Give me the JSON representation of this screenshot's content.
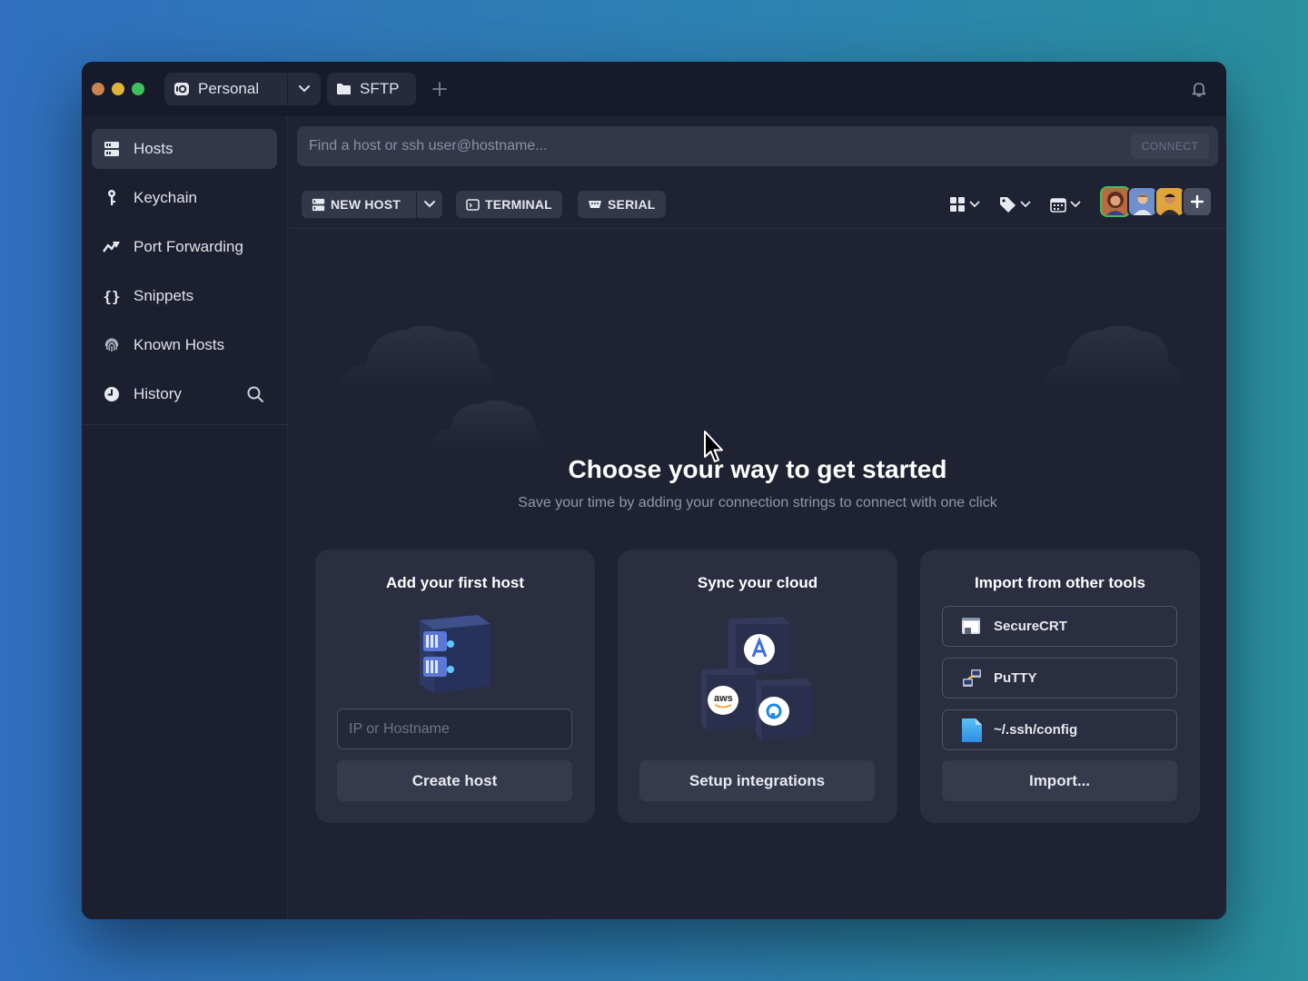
{
  "titlebar": {
    "vault_label": "Personal",
    "sftp_label": "SFTP"
  },
  "sidebar": {
    "items": [
      {
        "label": "Hosts",
        "icon": "hosts-icon"
      },
      {
        "label": "Keychain",
        "icon": "key-icon"
      },
      {
        "label": "Port Forwarding",
        "icon": "port-forwarding-icon"
      },
      {
        "label": "Snippets",
        "icon": "braces-icon"
      },
      {
        "label": "Known Hosts",
        "icon": "fingerprint-icon"
      },
      {
        "label": "History",
        "icon": "clock-icon"
      }
    ]
  },
  "search": {
    "placeholder": "Find a host or ssh user@hostname...",
    "connect_label": "CONNECT"
  },
  "toolbar": {
    "new_host_label": "NEW HOST",
    "terminal_label": "TERMINAL",
    "serial_label": "SERIAL"
  },
  "hero": {
    "title": "Choose your way to get started",
    "subtitle": "Save your time by adding your connection strings to connect with one click"
  },
  "cards": {
    "host": {
      "title": "Add your first host",
      "input_placeholder": "IP or Hostname",
      "button_label": "Create host"
    },
    "cloud": {
      "title": "Sync your cloud",
      "button_label": "Setup integrations"
    },
    "import": {
      "title": "Import from other tools",
      "tools": [
        "SecureCRT",
        "PuTTY",
        "~/.ssh/config"
      ],
      "button_label": "Import..."
    }
  },
  "colors": {
    "window_bg": "#1f2233",
    "titlebar_bg": "#161a2a",
    "card_bg": "#2a2e40",
    "active_item_bg": "#33374a"
  }
}
